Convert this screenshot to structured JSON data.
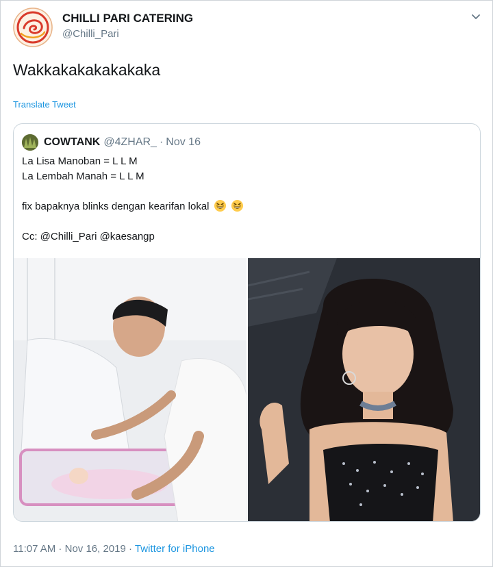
{
  "author": {
    "name": "CHILLI PARI CATERING",
    "handle": "@Chilli_Pari"
  },
  "tweet": {
    "text": "Wakkakakakakakaka",
    "translate_label": "Translate Tweet"
  },
  "quoted": {
    "name": "COWTANK",
    "handle": "@4ZHAR_",
    "separator": "·",
    "date": "Nov 16",
    "lines": [
      "La Lisa Manoban = L L M",
      "La Lembah Manah = L L M",
      "fix bapaknya blinks dengan kearifan lokal",
      "Cc: @Chilli_Pari @kaesangp"
    ],
    "emojis": [
      "grinning-squinting-face-icon",
      "grinning-squinting-face-icon"
    ]
  },
  "footer": {
    "time": "11:07 AM",
    "separator": " · ",
    "date": "Nov 16, 2019",
    "source": "Twitter for iPhone"
  },
  "colors": {
    "link": "#1b95e0",
    "muted": "#657786",
    "text": "#14171a",
    "border": "#ccd6dd"
  },
  "icons": {
    "menu": "chevron-down-icon",
    "author_avatar": "chilli-pari-logo-icon",
    "quoted_avatar": "cowtank-avatar-icon"
  }
}
